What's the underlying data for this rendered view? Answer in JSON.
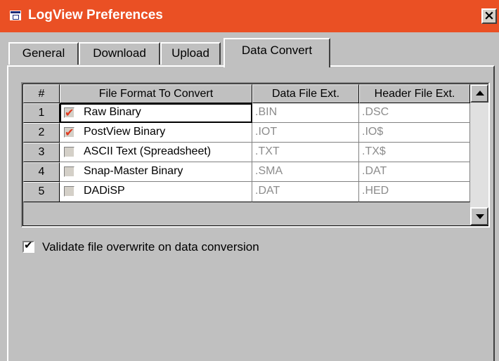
{
  "window": {
    "title": "LogView Preferences",
    "close_glyph": "×",
    "titlebar_color": "#ea5024"
  },
  "tabs": [
    {
      "label": "General",
      "active": false
    },
    {
      "label": "Download",
      "active": false
    },
    {
      "label": "Upload",
      "active": false
    },
    {
      "label": "Data Convert",
      "active": true
    }
  ],
  "grid": {
    "headers": [
      "#",
      "File Format To Convert",
      "Data File Ext.",
      "Header File Ext."
    ],
    "rows": [
      {
        "num": "1",
        "checked": true,
        "format": "Raw Binary",
        "data_ext": ".BIN",
        "header_ext": ".DSC"
      },
      {
        "num": "2",
        "checked": true,
        "format": "PostView Binary",
        "data_ext": ".IOT",
        "header_ext": ".IO$"
      },
      {
        "num": "3",
        "checked": false,
        "format": "ASCII Text (Spreadsheet)",
        "data_ext": ".TXT",
        "header_ext": ".TX$"
      },
      {
        "num": "4",
        "checked": false,
        "format": "Snap-Master Binary",
        "data_ext": ".SMA",
        "header_ext": ".DAT"
      },
      {
        "num": "5",
        "checked": false,
        "format": "DADiSP",
        "data_ext": ".DAT",
        "header_ext": ".HED"
      }
    ]
  },
  "options": {
    "validate_overwrite_label": "Validate file overwrite on data conversion",
    "validate_overwrite_checked": true
  },
  "icons": {
    "app": "app-window-icon",
    "close": "close-icon",
    "scroll_up": "scroll-up-arrow-icon",
    "scroll_down": "scroll-down-arrow-icon"
  }
}
